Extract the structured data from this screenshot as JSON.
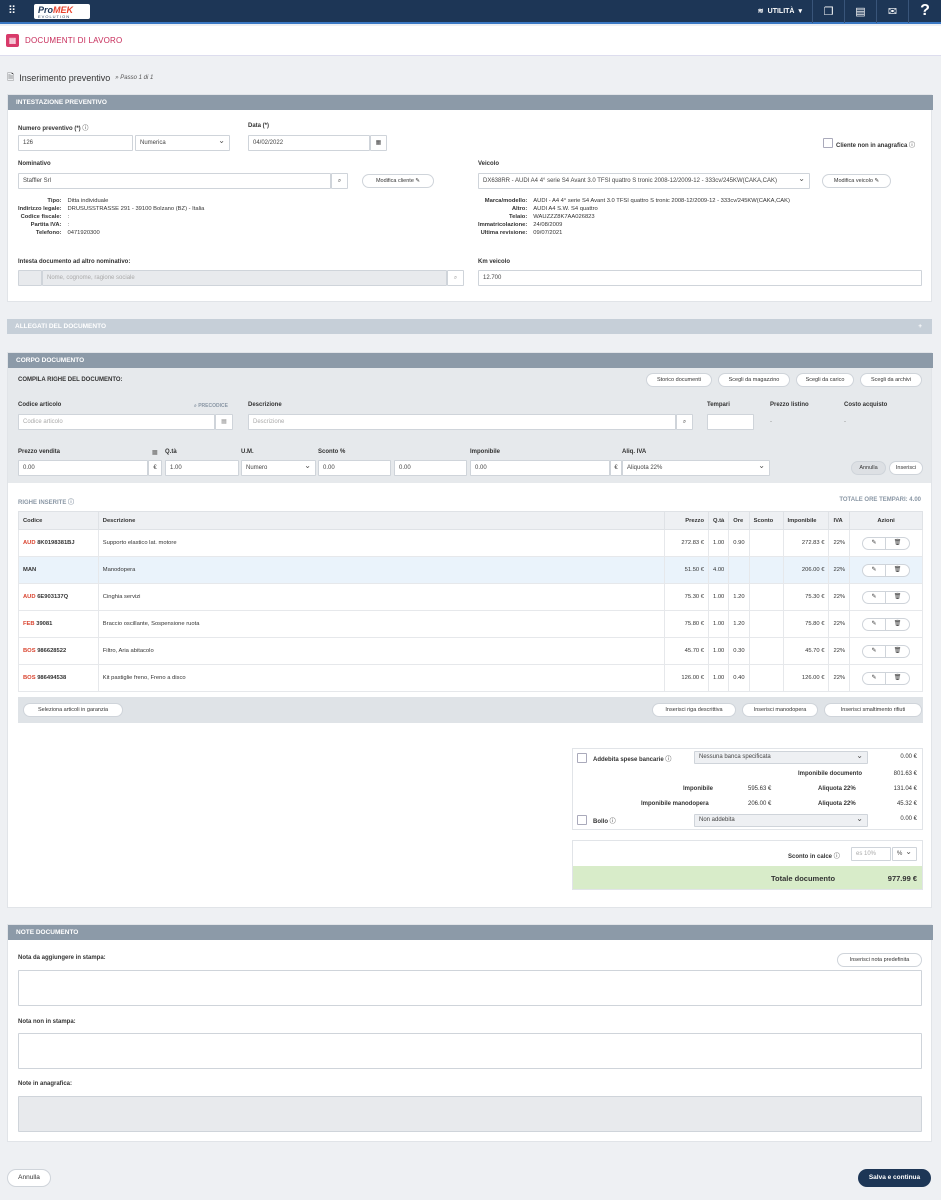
{
  "topbar": {
    "logo_main": "Pro",
    "logo_accent": "MEK",
    "logo_sub": "EVOLUTION",
    "utility": "UTILITÀ",
    "help": "?"
  },
  "page": {
    "title": "DOCUMENTI DI LAVORO"
  },
  "step": {
    "title": "Inserimento preventivo",
    "subtitle": "» Passo 1 di 1"
  },
  "intestazione": {
    "section": "INTESTAZIONE PREVENTIVO",
    "numero_label": "Numero preventivo (*)",
    "numero": "126",
    "numerazione": "Numerica",
    "data_label": "Data (*)",
    "data": "04/02/2022",
    "cliente_non": "Cliente non in anagrafica",
    "nominativo_label": "Nominativo",
    "nominativo": "Staffler Srl",
    "modifica_cliente": "Modifica cliente",
    "veicolo_label": "Veicolo",
    "veicolo": "DX638RR - AUDI A4 4° serie S4 Avant 3.0 TFSI quattro S tronic 2008-12/2009-12 - 333cv/245KW(CAKA,CAK)",
    "modifica_veicolo": "Modifica veicolo",
    "cliente_info": [
      {
        "k": "Tipo:",
        "v": "Ditta individuale"
      },
      {
        "k": "Indirizzo legale:",
        "v": "DRUSUSSTRASSE 291 - 39100 Bolzano (BZ) - Italia"
      },
      {
        "k": "Codice fiscale:",
        "v": ":"
      },
      {
        "k": "Partita IVA:",
        "v": ":"
      },
      {
        "k": "Telefono:",
        "v": "0471920300"
      }
    ],
    "veicolo_info": [
      {
        "k": "Marca/modello:",
        "v": "AUDI - A4 4° serie S4 Avant 3.0 TFSI quattro S tronic 2008-12/2009-12 - 333cv/245KW(CAKA,CAK)"
      },
      {
        "k": "Altro:",
        "v": "AUDI A4 S.W. S4 quattro"
      },
      {
        "k": "Telaio:",
        "v": "WAUZZZ8K7AA026823"
      },
      {
        "k": "Immatricolazione:",
        "v": "24/08/2009"
      },
      {
        "k": "Ultima revisione:",
        "v": "09/07/2021"
      }
    ],
    "intesta_label": "Intesta documento ad altro nominativo:",
    "intesta_placeholder": "Nome, cognome, ragione sociale",
    "km_label": "Km veicolo",
    "km": "12.700"
  },
  "allegati": {
    "section": "ALLEGATI DEL DOCUMENTO",
    "plus": "+"
  },
  "corpo": {
    "section": "CORPO DOCUMENTO",
    "compila": "COMPILA RIGHE DEL DOCUMENTO:",
    "buttons": [
      "Storico documenti",
      "Scegli da magazzino",
      "Scegli da carico",
      "Scegli da archivi"
    ],
    "codice_label": "Codice articolo",
    "precodice": "PRECODICE",
    "codice_placeholder": "Codice articolo",
    "descrizione_label": "Descrizione",
    "descrizione_placeholder": "Descrizione",
    "tempari_label": "Tempari",
    "prezzo_listino_label": "Prezzo listino",
    "costo_acquisto_label": "Costo acquisto",
    "dash": "-",
    "prezzo_vendita_label": "Prezzo vendita",
    "prezzo_vendita": "0.00",
    "euro": "€",
    "qta_label": "Q.tà",
    "qta": "1.00",
    "um_label": "U.M.",
    "um": "Numero",
    "sconto_label": "Sconto %",
    "sconto1": "0.00",
    "sconto2": "0.00",
    "imponibile_label": "Imponibile",
    "imponibile": "0.00",
    "aliq_label": "Aliq. IVA",
    "aliq": "Aliquota 22%",
    "annulla": "Annulla",
    "inserisci": "Inserisci",
    "righe_label": "RIGHE INSERITE",
    "totale_ore": "TOTALE ORE TEMPARI: 4.00"
  },
  "table": {
    "headers": [
      "Codice",
      "Descrizione",
      "Prezzo",
      "Q.tà",
      "Ore",
      "Sconto",
      "Imponibile",
      "IVA",
      "Azioni"
    ],
    "rows": [
      {
        "brand": "AUD",
        "code": "8K0198381BJ",
        "desc": "Supporto elastico lat. motore",
        "prezzo": "272.83 €",
        "qta": "1.00",
        "ore": "0.90",
        "sconto": "",
        "imp": "272.83 €",
        "iva": "22%"
      },
      {
        "brand": "",
        "code": "MAN",
        "desc": "Manodopera",
        "prezzo": "51.50 €",
        "qta": "4.00",
        "ore": "",
        "sconto": "",
        "imp": "206.00 €",
        "iva": "22%"
      },
      {
        "brand": "AUD",
        "code": "6E903137Q",
        "desc": "Cinghia servizi",
        "prezzo": "75.30 €",
        "qta": "1.00",
        "ore": "1.20",
        "sconto": "",
        "imp": "75.30 €",
        "iva": "22%"
      },
      {
        "brand": "FEB",
        "code": "39081",
        "desc": "Braccio oscillante, Sospensione ruota",
        "prezzo": "75.80 €",
        "qta": "1.00",
        "ore": "1.20",
        "sconto": "",
        "imp": "75.80 €",
        "iva": "22%"
      },
      {
        "brand": "BOS",
        "code": "986628522",
        "desc": "Filtro, Aria abitacolo",
        "prezzo": "45.70 €",
        "qta": "1.00",
        "ore": "0.30",
        "sconto": "",
        "imp": "45.70 €",
        "iva": "22%"
      },
      {
        "brand": "BOS",
        "code": "986494538",
        "desc": "Kit pastiglie freno, Freno a disco",
        "prezzo": "126.00 €",
        "qta": "1.00",
        "ore": "0.40",
        "sconto": "",
        "imp": "126.00 €",
        "iva": "22%"
      }
    ],
    "garanzia": "Seleziona articoli in garanzia",
    "riga_descrittiva": "Inserisci riga descrittiva",
    "manodopera": "Inserisci manodopera",
    "smaltimento": "Inserisci smaltimento rifiuti"
  },
  "riepilogo": {
    "spese_label": "Addebita spese bancarie",
    "banca": "Nessuna banca specificata",
    "spese": "0.00 €",
    "imp_doc_label": "Imponibile documento",
    "imp_doc": "801.63 €",
    "imponibile_label": "Imponibile",
    "imponibile": "595.63 €",
    "aliq1_label": "Aliquota 22%",
    "aliq1": "131.04 €",
    "imp_mano_label": "Imponibile manodopera",
    "imp_mano": "206.00 €",
    "aliq2_label": "Aliquota 22%",
    "aliq2": "45.32 €",
    "bollo_label": "Bollo",
    "bollo": "Non addebita",
    "bollo_val": "0.00 €",
    "sconto_calce_label": "Sconto in calce",
    "sconto_placeholder": "es 10%",
    "sconto_unit": "%",
    "totale_label": "Totale documento",
    "totale": "977.99 €"
  },
  "note": {
    "section": "NOTE DOCUMENTO",
    "stampa_label": "Nota da aggiungere in stampa:",
    "predefinita": "Inserisci nota predefinita",
    "non_stampa_label": "Nota non in stampa:",
    "anagrafica_label": "Note in anagrafica:"
  },
  "footer": {
    "annulla": "Annulla",
    "salva": "Salva e continua"
  }
}
